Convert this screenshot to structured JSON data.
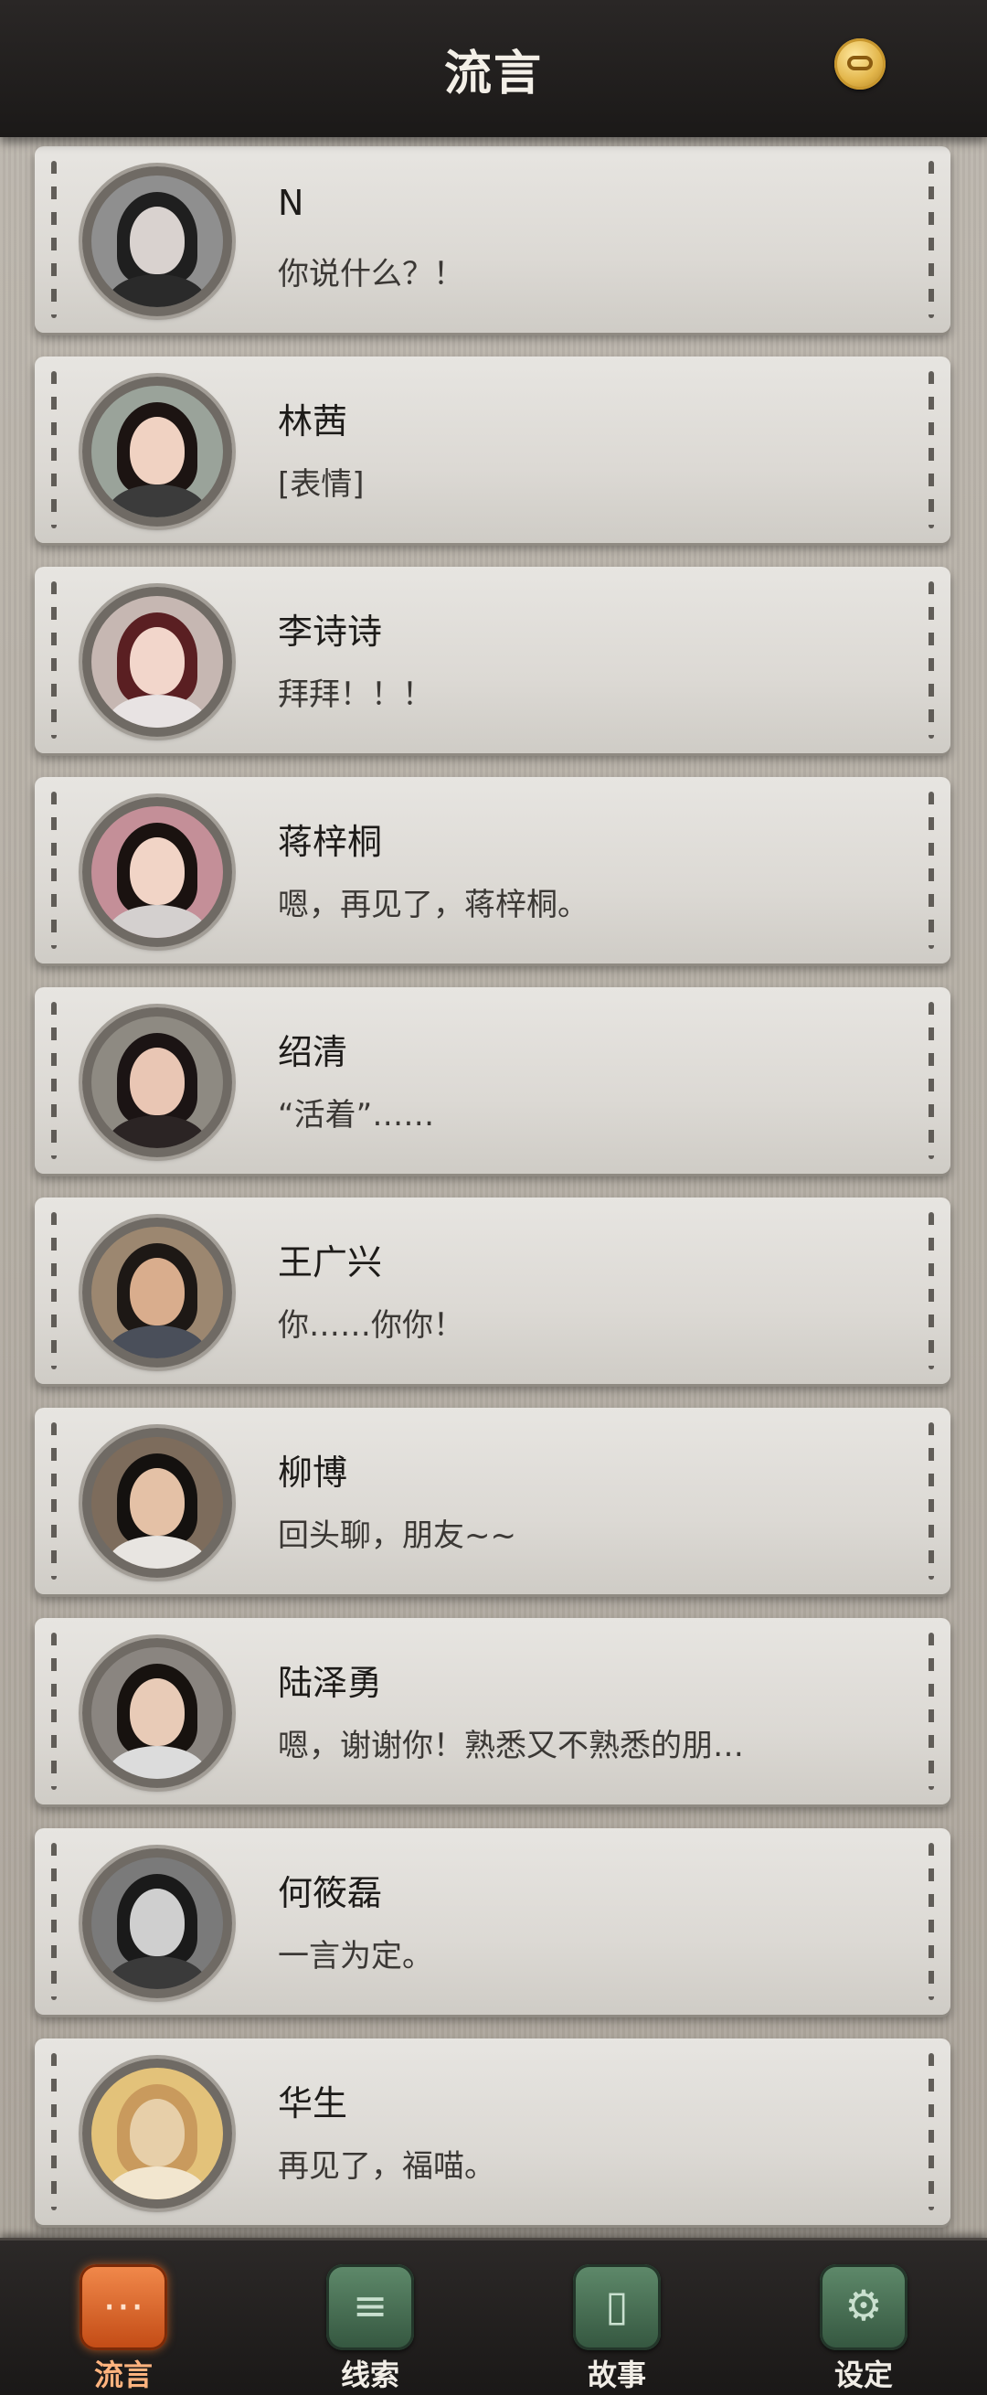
{
  "header": {
    "title": "流言",
    "currency_icon": "infinity-coin-icon"
  },
  "conversations": [
    {
      "name": "N",
      "message": "你说什么？！",
      "avatar": {
        "skin": "#d9d2cf",
        "hair": "#1f1f1f",
        "body": "#2a2a2a",
        "bg": "#8f8f8f"
      }
    },
    {
      "name": "林茜",
      "message": "[表情]",
      "avatar": {
        "skin": "#f0d2c2",
        "hair": "#1c1412",
        "body": "#3b3b3b",
        "bg": "#9aa39a"
      }
    },
    {
      "name": "李诗诗",
      "message": "拜拜！！！",
      "avatar": {
        "skin": "#f2d6cb",
        "hair": "#5a1f22",
        "body": "#e8e3e3",
        "bg": "#c6b7b2"
      }
    },
    {
      "name": "蒋梓桐",
      "message": "嗯，再见了，蒋梓桐。",
      "avatar": {
        "skin": "#f1d4c6",
        "hair": "#1a1210",
        "body": "#d4d0cf",
        "bg": "#c48f98"
      }
    },
    {
      "name": "绍清",
      "message": "“活着”……",
      "avatar": {
        "skin": "#e9c6b4",
        "hair": "#1b1414",
        "body": "#2b2424",
        "bg": "#8e8a82"
      }
    },
    {
      "name": "王广兴",
      "message": "你……你你！",
      "avatar": {
        "skin": "#d9ad8d",
        "hair": "#1d1815",
        "body": "#4a4f5a",
        "bg": "#9c8770"
      }
    },
    {
      "name": "柳博",
      "message": "回头聊，朋友~~",
      "avatar": {
        "skin": "#e4c1a6",
        "hair": "#14110f",
        "body": "#e8e5e1",
        "bg": "#7d6c5c"
      }
    },
    {
      "name": "陆泽勇",
      "message": "嗯，谢谢你！熟悉又不熟悉的朋…",
      "avatar": {
        "skin": "#e8cbb7",
        "hair": "#17120f",
        "body": "#dcdcdc",
        "bg": "#8a8580"
      }
    },
    {
      "name": "何筱磊",
      "message": "一言为定。",
      "avatar": {
        "skin": "#cfcfcf",
        "hair": "#1a1a1a",
        "body": "#3a3a3a",
        "bg": "#7a7a7a"
      }
    },
    {
      "name": "华生",
      "message": "再见了，福喵。",
      "avatar": {
        "skin": "#e7cfa9",
        "hair": "#c99a5d",
        "body": "#f2e6cf",
        "bg": "#e3c27a"
      }
    }
  ],
  "tabs": [
    {
      "label": "流言",
      "icon": "chat-bubble-icon",
      "glyph": "⋯",
      "active": true
    },
    {
      "label": "线索",
      "icon": "notes-icon",
      "glyph": "≡",
      "active": false
    },
    {
      "label": "故事",
      "icon": "book-icon",
      "glyph": "▯",
      "active": false
    },
    {
      "label": "设定",
      "icon": "gear-icon",
      "glyph": "⚙",
      "active": false
    }
  ]
}
